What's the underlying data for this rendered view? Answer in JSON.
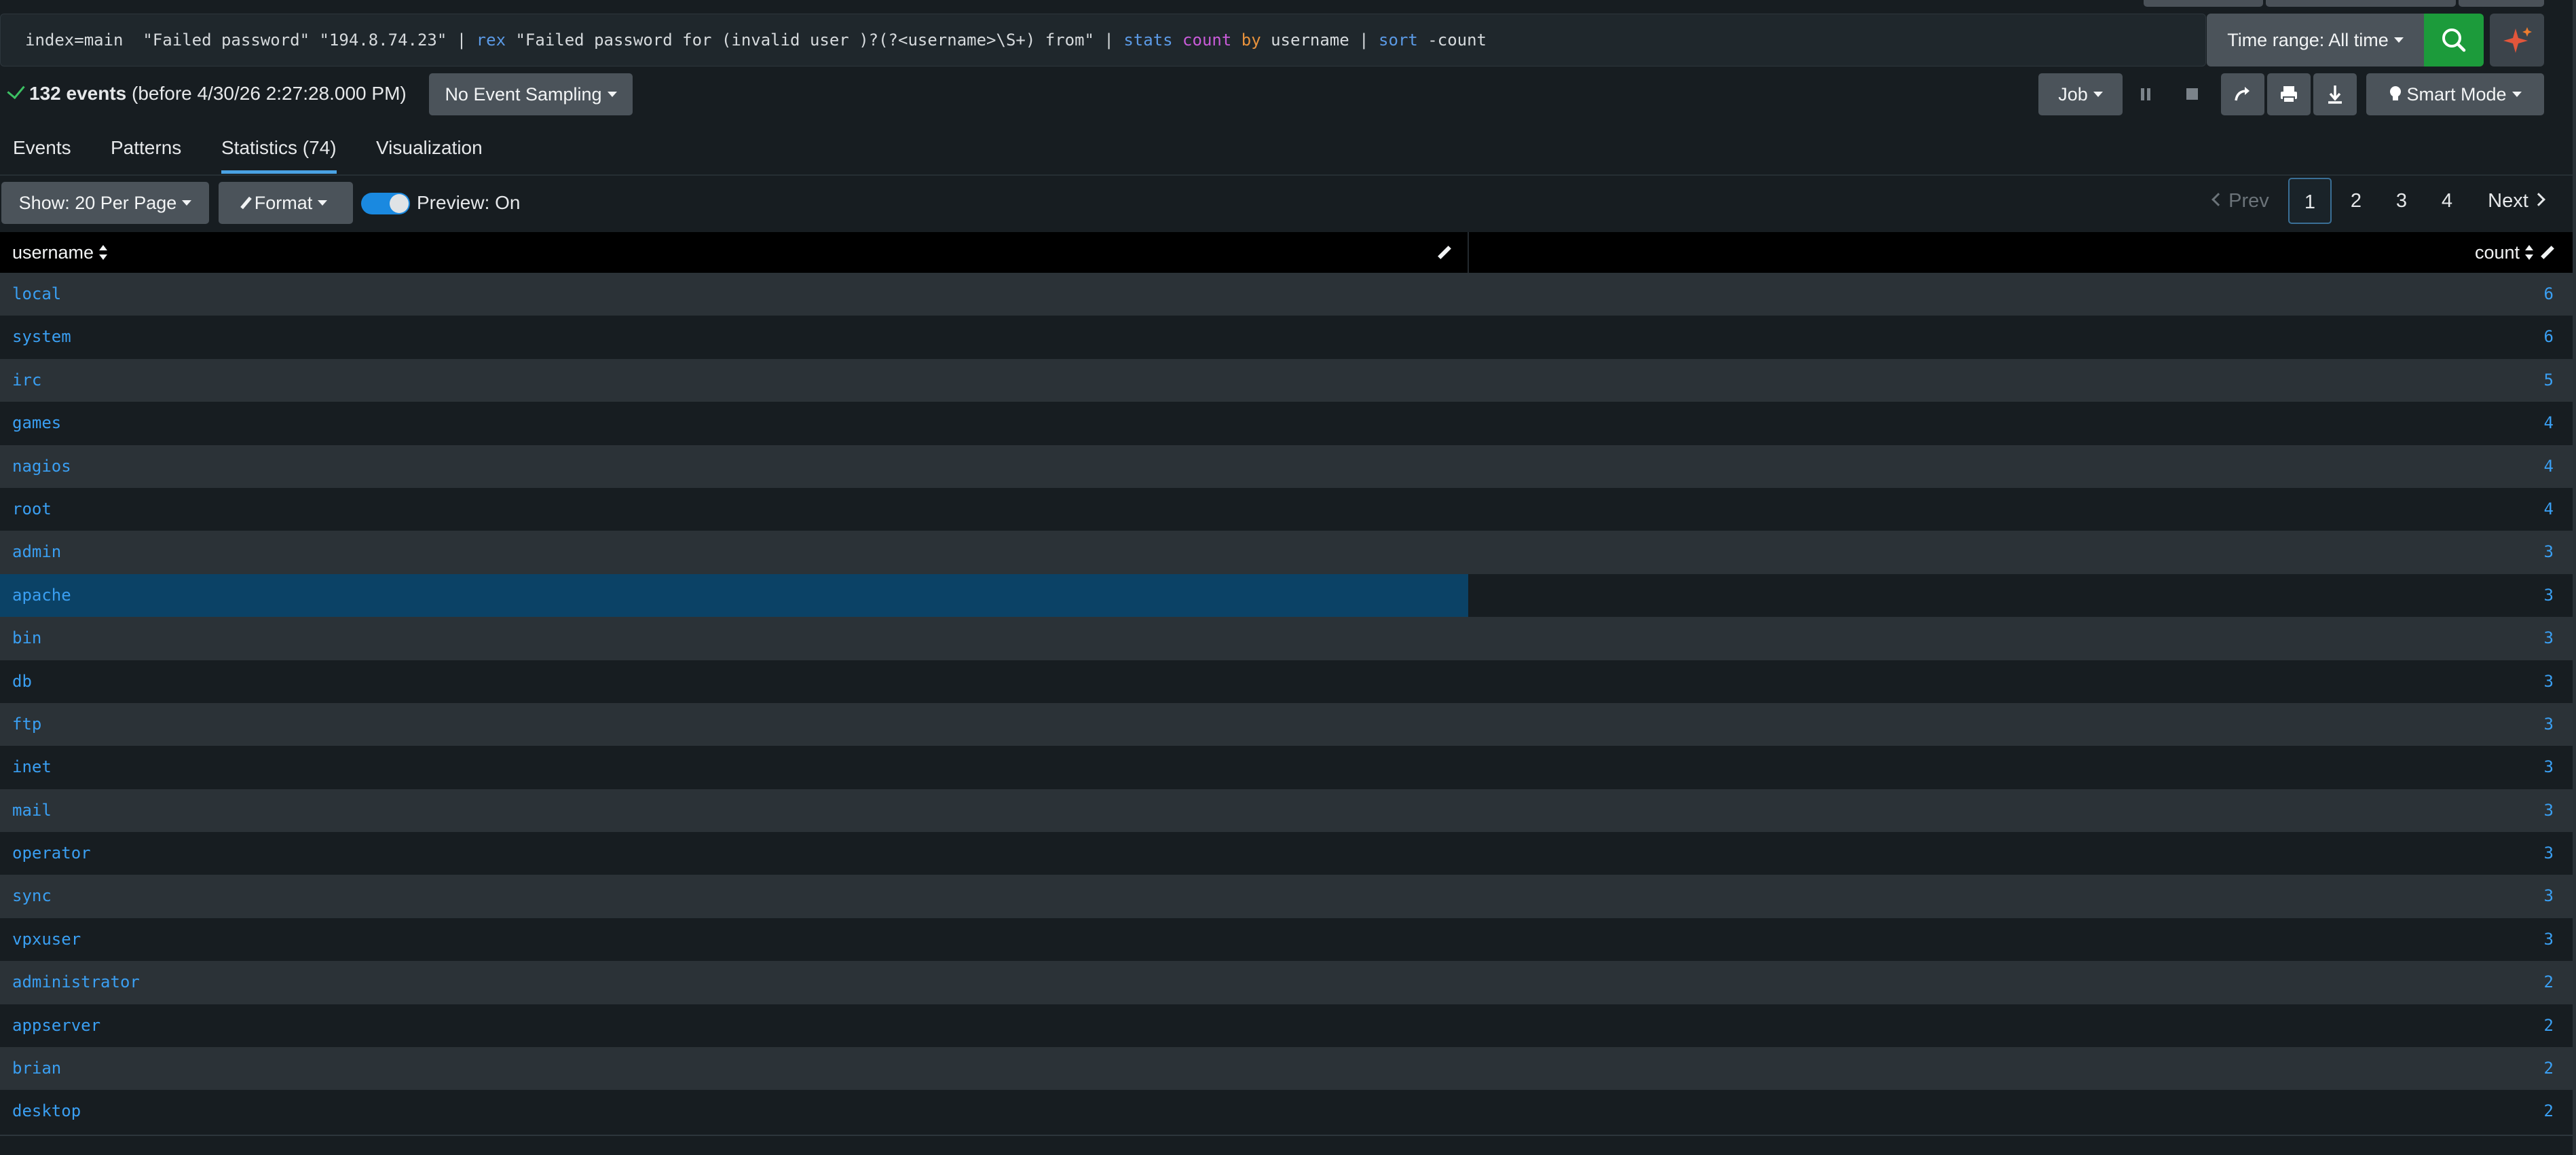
{
  "search": {
    "query_tokens": [
      {
        "t": "text",
        "v": "index=main  \"Failed password\" \"194.8.74.23\" | "
      },
      {
        "t": "cmd",
        "v": "rex"
      },
      {
        "t": "text",
        "v": " \"Failed password for (invalid user )?(?<username>\\S+) from\" | "
      },
      {
        "t": "cmd",
        "v": "stats"
      },
      {
        "t": "text",
        "v": " "
      },
      {
        "t": "func",
        "v": "count"
      },
      {
        "t": "text",
        "v": " "
      },
      {
        "t": "kw",
        "v": "by"
      },
      {
        "t": "text",
        "v": " username | "
      },
      {
        "t": "cmd",
        "v": "sort"
      },
      {
        "t": "text",
        "v": " -count"
      }
    ],
    "time_range_label": "Time range: All time",
    "search_icon": "search-icon",
    "ai_icon": "sparkle-icon"
  },
  "status": {
    "event_count": "132 events",
    "event_suffix": "(before 4/30/26 2:27:28.000 PM)",
    "sampling_label": "No Event Sampling",
    "job_label": "Job",
    "smart_mode_label": "Smart Mode"
  },
  "tabs": [
    {
      "label": "Events",
      "active": false
    },
    {
      "label": "Patterns",
      "active": false
    },
    {
      "label": "Statistics (74)",
      "active": true
    },
    {
      "label": "Visualization",
      "active": false
    }
  ],
  "controls": {
    "show_label": "Show: 20 Per Page",
    "format_label": "Format",
    "preview_label": "Preview: On",
    "preview_on": true
  },
  "pagination": {
    "prev_label": "Prev",
    "pages": [
      "1",
      "2",
      "3",
      "4"
    ],
    "current_page": "1",
    "next_label": "Next"
  },
  "table": {
    "columns": [
      "username",
      "count"
    ],
    "selected_row": 7,
    "rows": [
      {
        "username": "local",
        "count": "6"
      },
      {
        "username": "system",
        "count": "6"
      },
      {
        "username": "irc",
        "count": "5"
      },
      {
        "username": "games",
        "count": "4"
      },
      {
        "username": "nagios",
        "count": "4"
      },
      {
        "username": "root",
        "count": "4"
      },
      {
        "username": "admin",
        "count": "3"
      },
      {
        "username": "apache",
        "count": "3"
      },
      {
        "username": "bin",
        "count": "3"
      },
      {
        "username": "db",
        "count": "3"
      },
      {
        "username": "ftp",
        "count": "3"
      },
      {
        "username": "inet",
        "count": "3"
      },
      {
        "username": "mail",
        "count": "3"
      },
      {
        "username": "operator",
        "count": "3"
      },
      {
        "username": "sync",
        "count": "3"
      },
      {
        "username": "vpxuser",
        "count": "3"
      },
      {
        "username": "administrator",
        "count": "2"
      },
      {
        "username": "appserver",
        "count": "2"
      },
      {
        "username": "brian",
        "count": "2"
      },
      {
        "username": "desktop",
        "count": "2"
      }
    ]
  },
  "colors": {
    "background": "#171d21",
    "accent_blue": "#3a9ff2",
    "search_green": "#1c9b3b",
    "selected_row": "#0b4266"
  }
}
